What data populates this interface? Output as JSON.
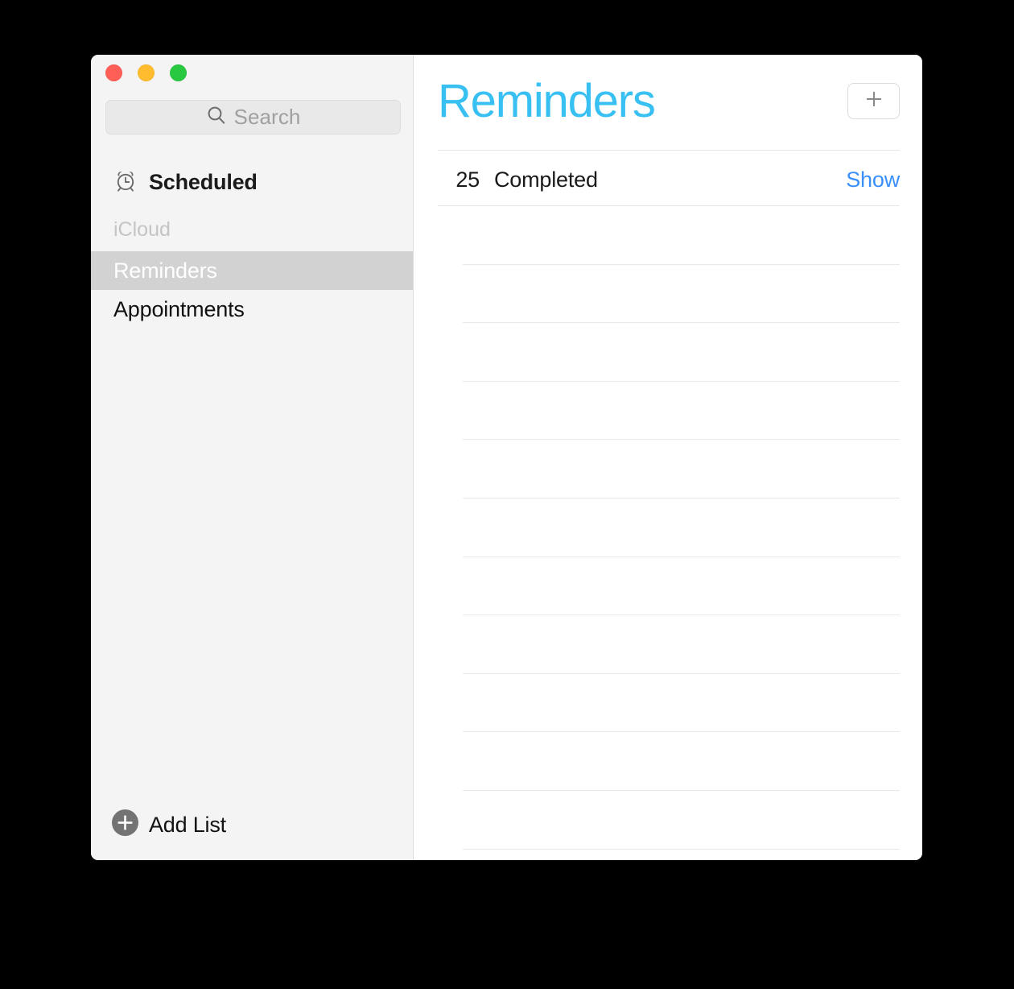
{
  "window": {
    "traffic_lights": [
      {
        "name": "close",
        "color": "#ff5f57"
      },
      {
        "name": "minimize",
        "color": "#febc2e"
      },
      {
        "name": "zoom",
        "color": "#28c840"
      }
    ]
  },
  "sidebar": {
    "search": {
      "icon": "search-icon",
      "placeholder": "Search",
      "value": ""
    },
    "smart_lists": [
      {
        "label": "Scheduled",
        "icon": "alarm-clock-icon",
        "selected": false
      }
    ],
    "sections": [
      {
        "header": "iCloud",
        "items": [
          {
            "label": "Reminders",
            "selected": true
          },
          {
            "label": "Appointments",
            "selected": false
          }
        ]
      }
    ],
    "add_list": {
      "label": "Add List",
      "icon": "plus-circle-icon"
    }
  },
  "content": {
    "title": "Reminders",
    "title_color": "#39c0f2",
    "add_button": {
      "icon": "plus-icon",
      "label": "+"
    },
    "completed": {
      "count": "25",
      "label": "Completed",
      "show_link": "Show",
      "link_color": "#3b8ffb"
    },
    "empty_rows": 12
  }
}
